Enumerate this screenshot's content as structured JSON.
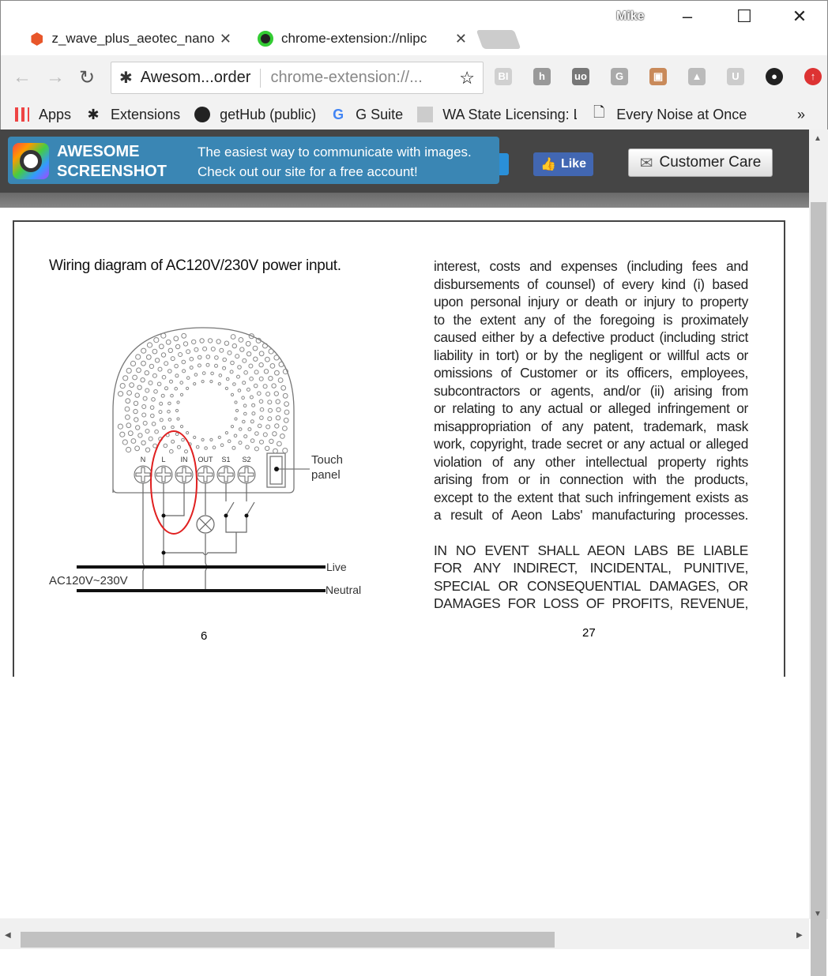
{
  "window": {
    "profile": "Mike",
    "minimize": "–",
    "maximize": "☐",
    "close": "✕"
  },
  "tabs": [
    {
      "label": "z_wave_plus_aeotec_nano",
      "icon": "magento-icon",
      "close": "✕"
    },
    {
      "label": "chrome-extension://nlipc",
      "icon": "awesome-screenshot-icon",
      "close": "✕"
    }
  ],
  "toolbar": {
    "back": "←",
    "forward": "→",
    "reload": "↻",
    "site_name": "Awesom...order",
    "url": "chrome-extension://...",
    "star": "☆",
    "extensions": [
      {
        "label": "BI",
        "color": "#d0d0d0"
      },
      {
        "label": "h",
        "color": "#999"
      },
      {
        "label": "uo",
        "color": "#777"
      },
      {
        "label": "G",
        "color": "#aaa"
      },
      {
        "label": "▣",
        "color": "#c98a5a"
      },
      {
        "label": "▲",
        "color": "#bbb"
      },
      {
        "label": "U",
        "color": "#ccc"
      },
      {
        "label": "●",
        "color": "#222"
      },
      {
        "label": "↑",
        "color": "#d33"
      }
    ]
  },
  "bookmarks": [
    {
      "label": "Apps"
    },
    {
      "label": "Extensions"
    },
    {
      "label": "getHub (public)"
    },
    {
      "label": "G Suite"
    },
    {
      "label": "WA State Licensing: L"
    },
    {
      "label": "Every Noise at Once"
    }
  ],
  "bookmarks_more": "»",
  "header": {
    "brand_line1": "AWESOME",
    "brand_line2": "SCREENSHOT",
    "tagline1": "The easiest way to communicate with images.",
    "tagline2": "Check out our site for a free account!",
    "like_label": "Like",
    "customer_care_label": "Customer Care",
    "accent": "#3a86b4"
  },
  "document": {
    "left_title": "Wiring diagram of AC120V/230V power input.",
    "terminals": [
      "N",
      "L",
      "IN",
      "OUT",
      "S1",
      "S2"
    ],
    "touch_panel_line1": "Touch",
    "touch_panel_line2": "panel",
    "live_label": "Live",
    "neutral_label": "Neutral",
    "voltage_label": "AC120V~230V",
    "left_page_number": "6",
    "right_page_number": "27",
    "right_lines": [
      "interest, costs and expenses (including fees and",
      "disbursements of counsel) of every kind (i) based",
      "upon personal injury or death or injury to property",
      "to the extent any of the foregoing is proximately",
      "caused either by a defective product (including strict",
      "liability in tort) or by the negligent or willful acts or",
      "omissions of Customer or its officers, employees,",
      "subcontractors or agents, and/or (ii) arising from",
      "or relating to any actual or alleged infringement or",
      "misappropriation of any patent, trademark, mask",
      "work, copyright, trade secret or any actual or alleged",
      "violation of any other intellectual property rights",
      "arising from or in connection with the products,",
      "except to the extent that such infringement exists as",
      "a result of Aeon Labs' manufacturing processes."
    ],
    "right_caps_lines": [
      "IN NO EVENT SHALL AEON LABS BE LIABLE",
      "FOR ANY INDIRECT, INCIDENTAL, PUNITIVE,",
      "SPECIAL OR CONSEQUENTIAL DAMAGES, OR",
      "DAMAGES FOR LOSS OF PROFITS, REVENUE,"
    ]
  }
}
